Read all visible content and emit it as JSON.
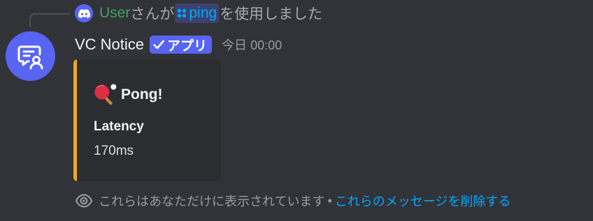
{
  "command_line": {
    "user": "User",
    "mid_text": "さんが",
    "command_name": "ping",
    "after_text": "を使用しました"
  },
  "message": {
    "bot_name": "VC Notice",
    "badge_label": "アプリ",
    "timestamp": "今日 00:00"
  },
  "embed": {
    "accent_color": "#f0a81c",
    "title_icon": "ping-pong-icon",
    "title": "Pong!",
    "field_name": "Latency",
    "field_value": "170ms"
  },
  "ephemeral_note": {
    "text": "これらはあなただけに表示されています",
    "separator": "•",
    "dismiss_link": "これらのメッセージを削除する"
  },
  "colors": {
    "background": "#323339",
    "blurple": "#5865f2",
    "link": "#00a8fc",
    "username_green": "#3ba55c"
  }
}
